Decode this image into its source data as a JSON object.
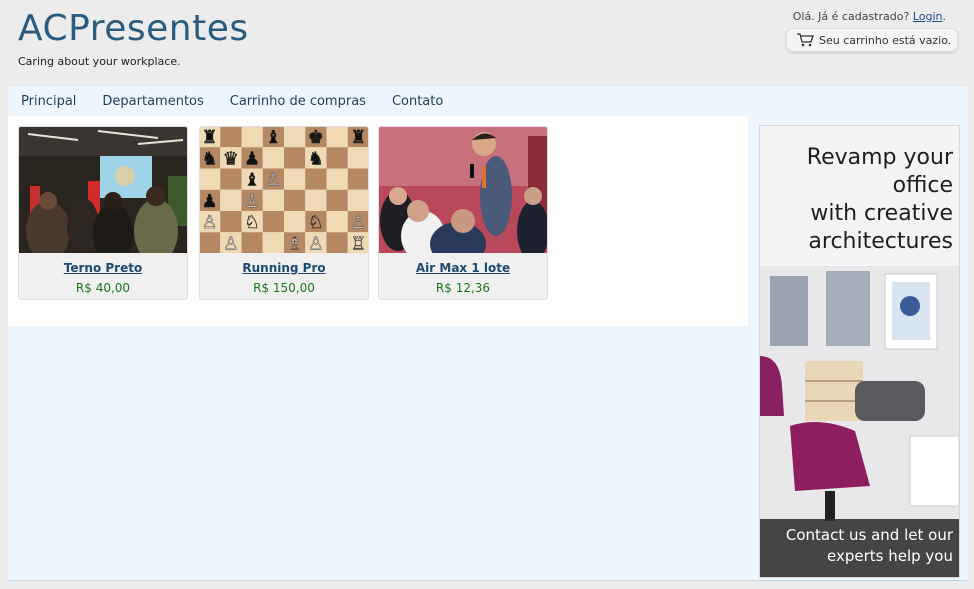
{
  "header": {
    "brand": "ACPresentes",
    "tagline": "Caring about your workplace.",
    "greeting": "Olá. Já é cadastrado?",
    "login_label": "Login",
    "greeting_suffix": ".",
    "cart_text": "Seu carrinho está vazio."
  },
  "nav": {
    "items": [
      {
        "label": "Principal"
      },
      {
        "label": "Departamentos"
      },
      {
        "label": "Carrinho de compras"
      },
      {
        "label": "Contato"
      }
    ]
  },
  "products": [
    {
      "name": "Terno Preto",
      "price": "R$ 40,00"
    },
    {
      "name": "Running Pro",
      "price": "R$ 150,00"
    },
    {
      "name": "Air Max 1 lote",
      "price": "R$ 12,36"
    }
  ],
  "ad": {
    "headline": "Revamp your\noffice\nwith creative\narchitectures",
    "footer": "Contact us and let our\nexperts help you"
  },
  "colors": {
    "brand": "#2a5c80",
    "nav_bg": "#eef6fd",
    "price": "#1a7a1a",
    "link": "#1c4a72"
  }
}
